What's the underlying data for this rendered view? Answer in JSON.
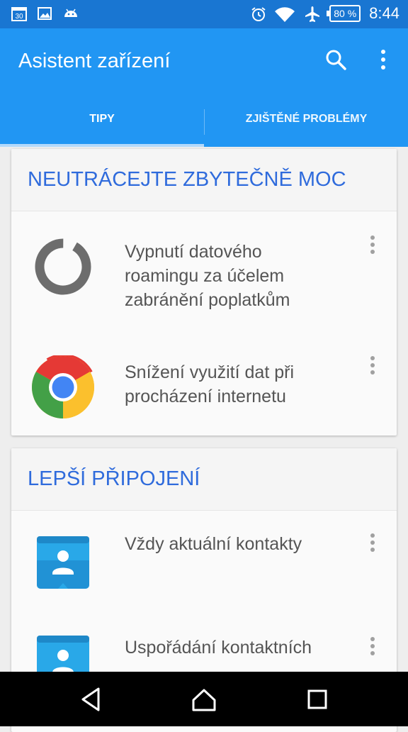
{
  "status_bar": {
    "time": "8:44",
    "battery": "80 %",
    "calendar_day": "30",
    "icons": [
      "calendar-icon",
      "image-icon",
      "android-icon",
      "alarm-icon",
      "wifi-icon",
      "airplane-icon",
      "battery-icon"
    ]
  },
  "app_bar": {
    "title": "Asistent zařízení",
    "actions": [
      "search-icon",
      "more-vert-icon"
    ]
  },
  "tabs": [
    {
      "label": "TIPY",
      "selected": true
    },
    {
      "label": "ZJIŠTĚNÉ PROBLÉMY",
      "selected": false
    }
  ],
  "cards": [
    {
      "title": "NEUTRÁCEJTE ZBYTEČNĚ MOC",
      "items": [
        {
          "icon": "data-roaming-icon",
          "text": "Vypnutí datového roamingu za účelem zabránění poplatkům"
        },
        {
          "icon": "chrome-icon",
          "text": "Snížení využití dat při procházení internetu"
        }
      ]
    },
    {
      "title": "LEPŠÍ PŘIPOJENÍ",
      "items": [
        {
          "icon": "contacts-icon",
          "text": "Vždy aktuální kontakty"
        },
        {
          "icon": "contacts-icon",
          "text": "Uspořádání kontaktních"
        }
      ]
    }
  ],
  "nav_bar": [
    "back-icon",
    "home-icon",
    "recents-icon"
  ],
  "colors": {
    "status_bar": "#1976d2",
    "app_bar": "#2196f3",
    "card_title": "#2f6bdc",
    "background": "#eeeeee"
  }
}
